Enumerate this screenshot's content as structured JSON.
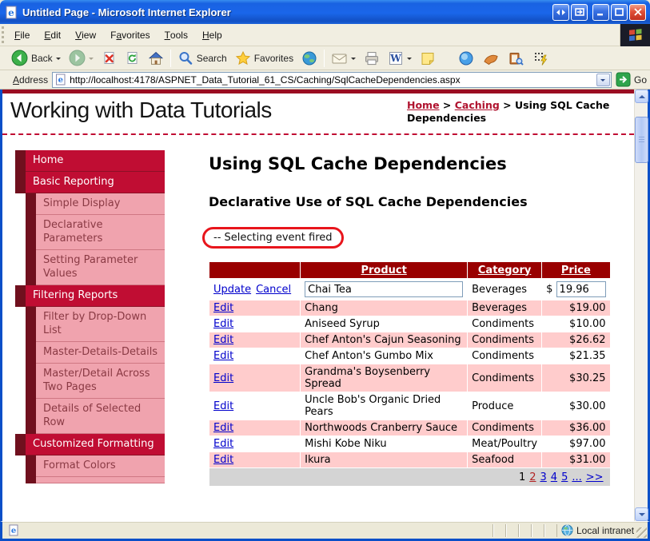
{
  "window": {
    "title": "Untitled Page - Microsoft Internet Explorer"
  },
  "menu": {
    "items": [
      {
        "label": "File",
        "key": 0
      },
      {
        "label": "Edit",
        "key": 0
      },
      {
        "label": "View",
        "key": 0
      },
      {
        "label": "Favorites",
        "key": 1
      },
      {
        "label": "Tools",
        "key": 0
      },
      {
        "label": "Help",
        "key": 0
      }
    ]
  },
  "toolbar": {
    "back": "Back",
    "search": "Search",
    "favorites": "Favorites"
  },
  "address": {
    "label": "Address",
    "key": 0,
    "url": "http://localhost:4178/ASPNET_Data_Tutorial_61_CS/Caching/SqlCacheDependencies.aspx",
    "go": "Go"
  },
  "page": {
    "site_title": "Working with Data Tutorials",
    "breadcrumb": {
      "separator": ">",
      "items": [
        {
          "label": "Home",
          "link": true
        },
        {
          "label": "Caching",
          "link": true
        },
        {
          "label": "Using SQL Cache Dependencies",
          "link": false
        }
      ]
    },
    "sidebar": [
      {
        "label": "Home",
        "level": 1
      },
      {
        "label": "Basic Reporting",
        "level": 1
      },
      {
        "label": "Simple Display",
        "level": 2
      },
      {
        "label": "Declarative Parameters",
        "level": 2
      },
      {
        "label": "Setting Parameter Values",
        "level": 2
      },
      {
        "label": "Filtering Reports",
        "level": 1
      },
      {
        "label": "Filter by Drop-Down List",
        "level": 2
      },
      {
        "label": "Master-Details-Details",
        "level": 2
      },
      {
        "label": "Master/Detail Across Two Pages",
        "level": 2
      },
      {
        "label": "Details of Selected Row",
        "level": 2
      },
      {
        "label": "Customized Formatting",
        "level": 1
      },
      {
        "label": "Format Colors",
        "level": 2
      }
    ],
    "heading": "Using SQL Cache Dependencies",
    "subheading": "Declarative Use of SQL Cache Dependencies",
    "event_message": "-- Selecting event fired",
    "grid": {
      "headers": {
        "product": "Product",
        "category": "Category",
        "price": "Price"
      },
      "edit_label": "Edit",
      "edit_row": {
        "update": "Update",
        "cancel": "Cancel",
        "product": "Chai Tea",
        "category": "Beverages",
        "currency": "$",
        "price": "19.96"
      },
      "rows": [
        {
          "product": "Chang",
          "category": "Beverages",
          "price": "$19.00"
        },
        {
          "product": "Aniseed Syrup",
          "category": "Condiments",
          "price": "$10.00"
        },
        {
          "product": "Chef Anton's Cajun Seasoning",
          "category": "Condiments",
          "price": "$26.62"
        },
        {
          "product": "Chef Anton's Gumbo Mix",
          "category": "Condiments",
          "price": "$21.35"
        },
        {
          "product": "Grandma's Boysenberry Spread",
          "category": "Condiments",
          "price": "$30.25"
        },
        {
          "product": "Uncle Bob's Organic Dried Pears",
          "category": "Produce",
          "price": "$30.00"
        },
        {
          "product": "Northwoods Cranberry Sauce",
          "category": "Condiments",
          "price": "$36.00"
        },
        {
          "product": "Mishi Kobe Niku",
          "category": "Meat/Poultry",
          "price": "$97.00"
        },
        {
          "product": "Ikura",
          "category": "Seafood",
          "price": "$31.00"
        }
      ],
      "pager": {
        "current": "1",
        "links": [
          {
            "label": "2",
            "visited": true
          },
          {
            "label": "3",
            "visited": false
          },
          {
            "label": "4",
            "visited": false
          },
          {
            "label": "5",
            "visited": false
          },
          {
            "label": "...",
            "visited": false
          },
          {
            "label": ">>",
            "visited": false
          }
        ]
      }
    }
  },
  "statusbar": {
    "zone": "Local intranet"
  },
  "icons": {
    "back-icon": "green circle left arrow",
    "forward-icon": "dim green circle right arrow",
    "stop-icon": "page with red x",
    "refresh-icon": "page with green arrows",
    "home-icon": "house",
    "search-icon": "magnifier",
    "favorites-icon": "yellow star",
    "media-icon": "globe",
    "mail-icon": "envelope",
    "print-icon": "printer",
    "edit-word-icon": "W document",
    "notes-icon": "yellow note",
    "messenger-icon": "blue sphere",
    "tool-icon": "orange tool",
    "research-icon": "book with magnifier",
    "snippet-icon": "dots with lightning",
    "ie-page-icon": "document with blue e",
    "go-icon": "green arrow box",
    "zone-globe-icon": "globe",
    "windows-logo": "windows flag"
  },
  "colors": {
    "accent_crimson": "#c00d33",
    "maroon_dark": "#70101e",
    "sidebar_pink": "#f0a3ae",
    "grid_header": "#990000",
    "grid_alt_row": "#ffcccc",
    "pager_bg": "#d4d4d4",
    "link_blue": "#0000cc",
    "visited_red": "#b22222",
    "annotation_red": "#e8151c",
    "titlebar_blue": "#1a66ea",
    "chrome_beige": "#ece9d8",
    "top_stripe": "#9b0d22"
  }
}
